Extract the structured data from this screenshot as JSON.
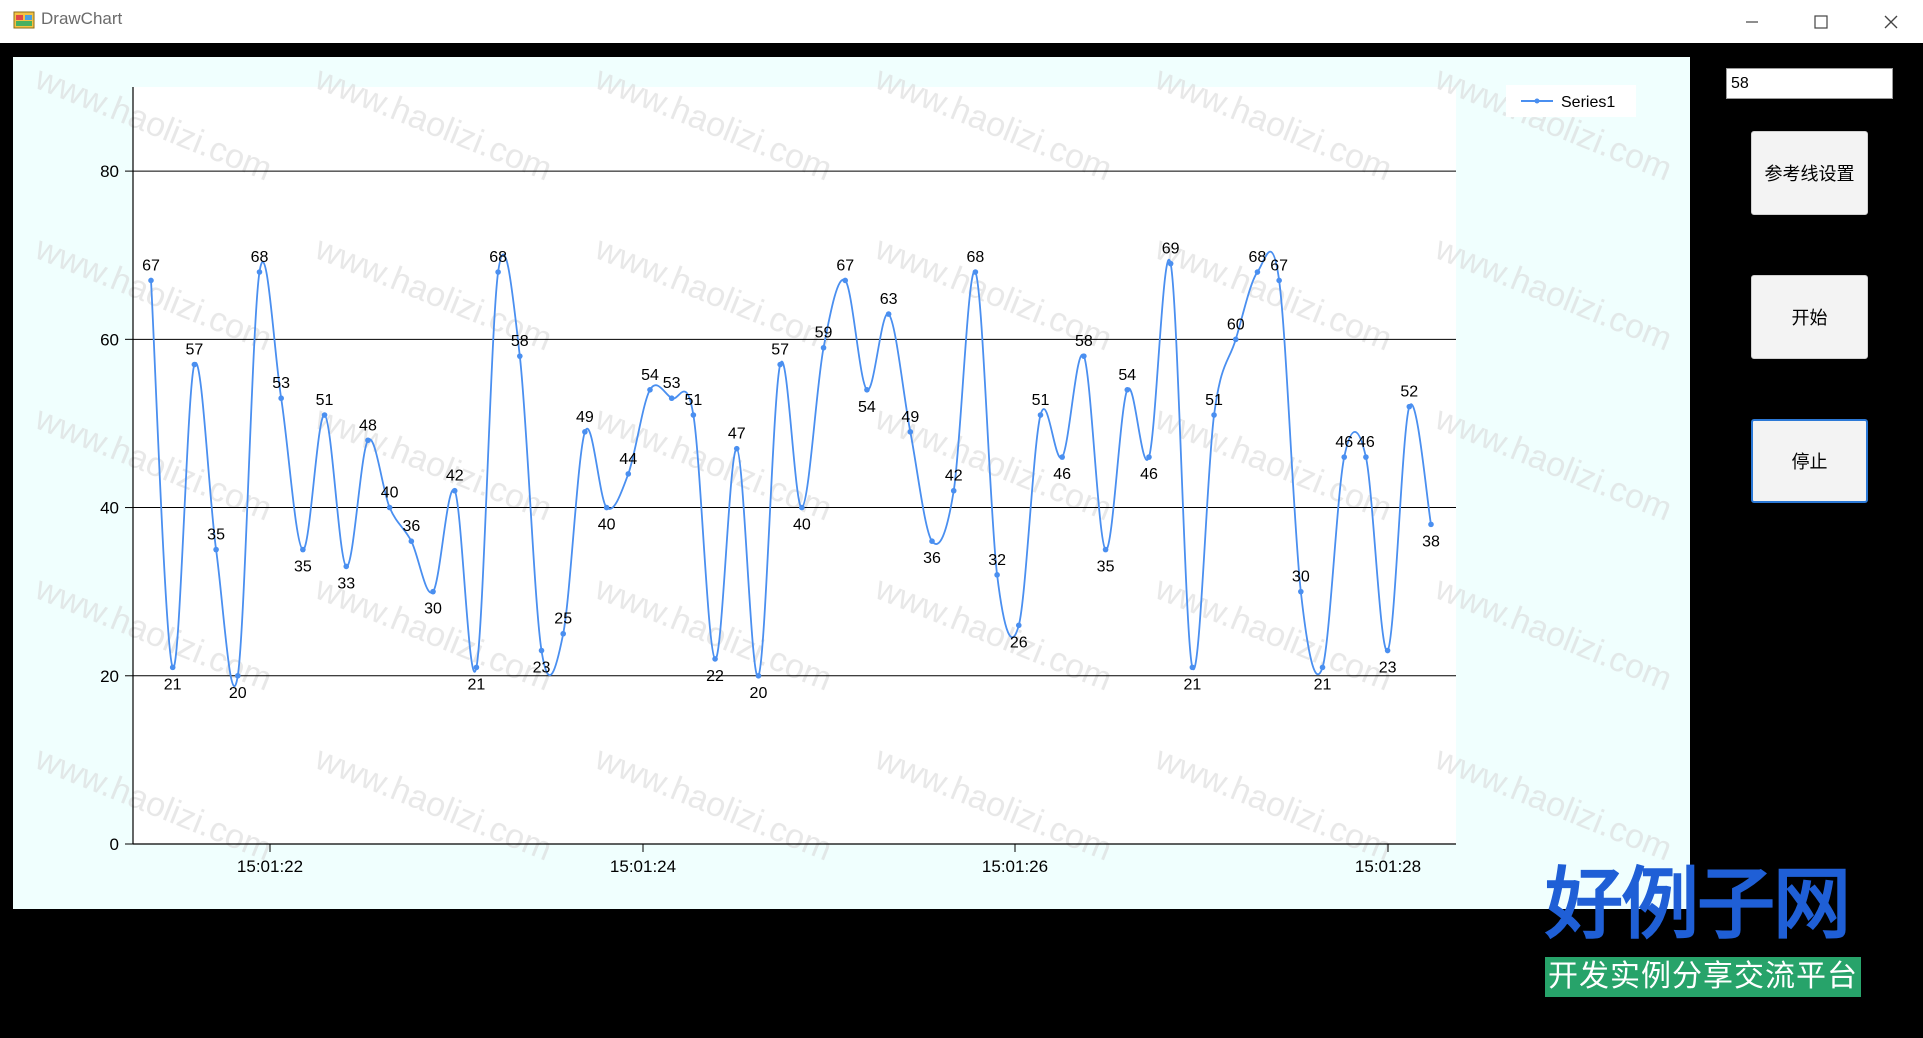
{
  "window": {
    "title": "DrawChart",
    "minimize_icon": "minimize-icon",
    "maximize_icon": "maximize-icon",
    "close_icon": "close-icon"
  },
  "sidebar": {
    "input_value": "58",
    "buttons": [
      {
        "label": "参考线设置"
      },
      {
        "label": "开始"
      },
      {
        "label": "停止"
      }
    ]
  },
  "watermark": "www.haolizi.com",
  "logo": {
    "main": "好例子网",
    "sub": "开发实例分享交流平台"
  },
  "colors": {
    "series": "#4a8ff0",
    "chart_bg": "#f0fffe",
    "logo_blue": "#1f5fd6",
    "logo_green": "#27a36a"
  },
  "chart_data": {
    "type": "line",
    "smooth": true,
    "legend": {
      "position": "top-right",
      "entries": [
        "Series1"
      ]
    },
    "y_ticks": [
      0,
      20,
      40,
      60,
      80
    ],
    "ylim": [
      0,
      90
    ],
    "x_ticks": [
      "15:01:22",
      "15:01:24",
      "15:01:26",
      "15:01:28"
    ],
    "grid": "horizontal",
    "series": [
      {
        "name": "Series1",
        "values": [
          67,
          21,
          57,
          35,
          20,
          68,
          53,
          35,
          51,
          33,
          48,
          40,
          36,
          30,
          42,
          21,
          68,
          58,
          23,
          25,
          49,
          40,
          44,
          54,
          53,
          51,
          22,
          47,
          20,
          57,
          40,
          59,
          67,
          54,
          63,
          49,
          36,
          42,
          68,
          32,
          26,
          51,
          46,
          58,
          35,
          54,
          46,
          69,
          21,
          51,
          60,
          68,
          67,
          30,
          21,
          46,
          46,
          23,
          52,
          38
        ]
      }
    ]
  }
}
